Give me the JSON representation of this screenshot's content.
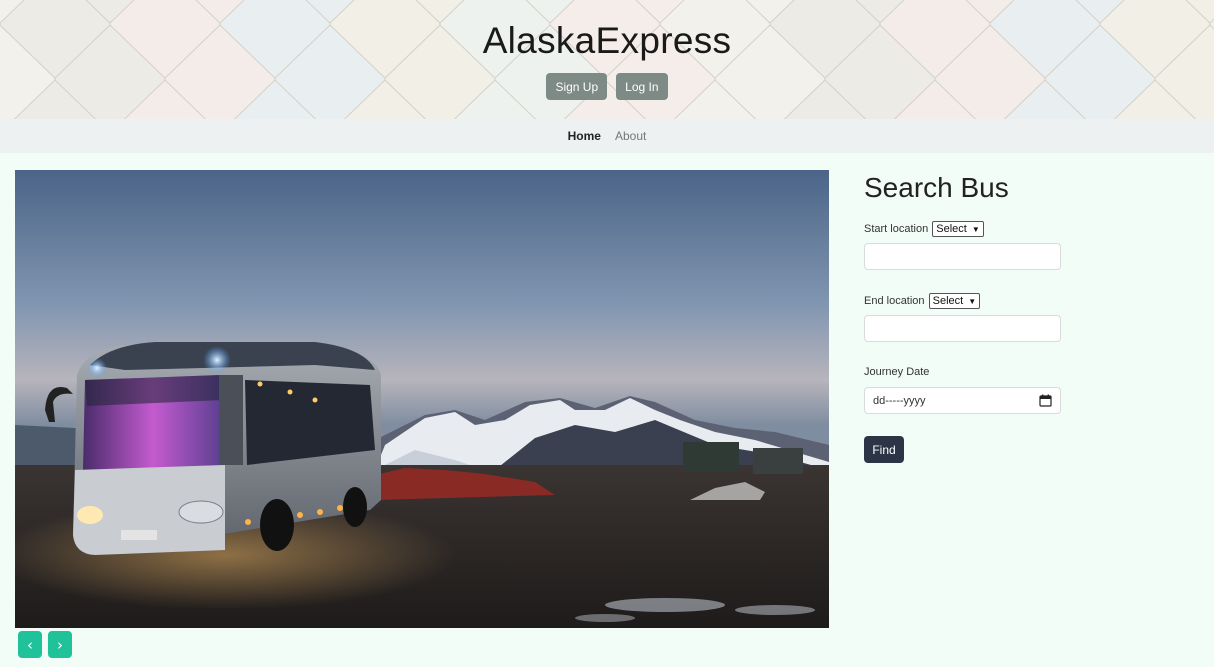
{
  "header": {
    "title": "AlaskaExpress",
    "signup_label": "Sign Up",
    "login_label": "Log In"
  },
  "nav": {
    "items": [
      {
        "label": "Home",
        "active": true
      },
      {
        "label": "About",
        "active": false
      }
    ]
  },
  "carousel": {
    "image_subject": "bus-at-dusk-with-snowy-mountains",
    "prev_icon": "chevron-left-icon",
    "next_icon": "chevron-right-icon",
    "prev_glyph": "‹",
    "next_glyph": "›"
  },
  "search": {
    "title": "Search Bus",
    "start_label": "Start location",
    "start_select": "Select",
    "start_value": "",
    "end_label": "End location",
    "end_select": "Select",
    "end_value": "",
    "date_label": "Journey Date",
    "date_placeholder": "dd-----yyyy",
    "find_label": "Find"
  },
  "colors": {
    "page_bg": "#f3fdf8",
    "nav_bg": "#edf1f1",
    "auth_button": "#7d8a86",
    "carousel_button": "#20c29a",
    "find_button": "#2b3545"
  }
}
